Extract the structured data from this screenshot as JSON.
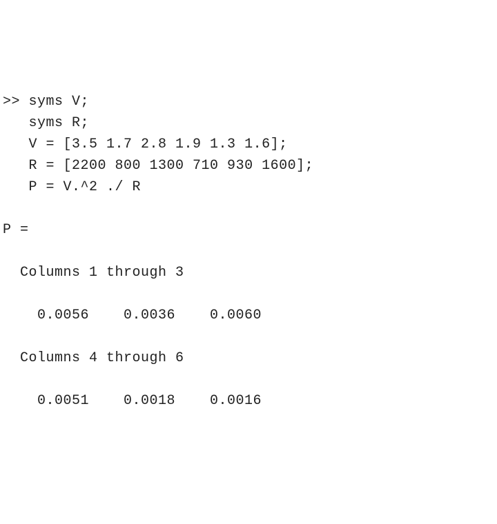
{
  "console": {
    "prompt": ">>",
    "input_lines": [
      "syms V;",
      "syms R;",
      "V = [3.5 1.7 2.8 1.9 1.3 1.6];",
      "R = [2200 800 1300 710 930 1600];",
      "P = V.^2 ./ R"
    ],
    "output": {
      "var_header": "P =",
      "section1_label": "Columns 1 through 3",
      "section1_values": "    0.0056    0.0036    0.0060",
      "section2_label": "Columns 4 through 6",
      "section2_values": "    0.0051    0.0018    0.0016"
    }
  }
}
